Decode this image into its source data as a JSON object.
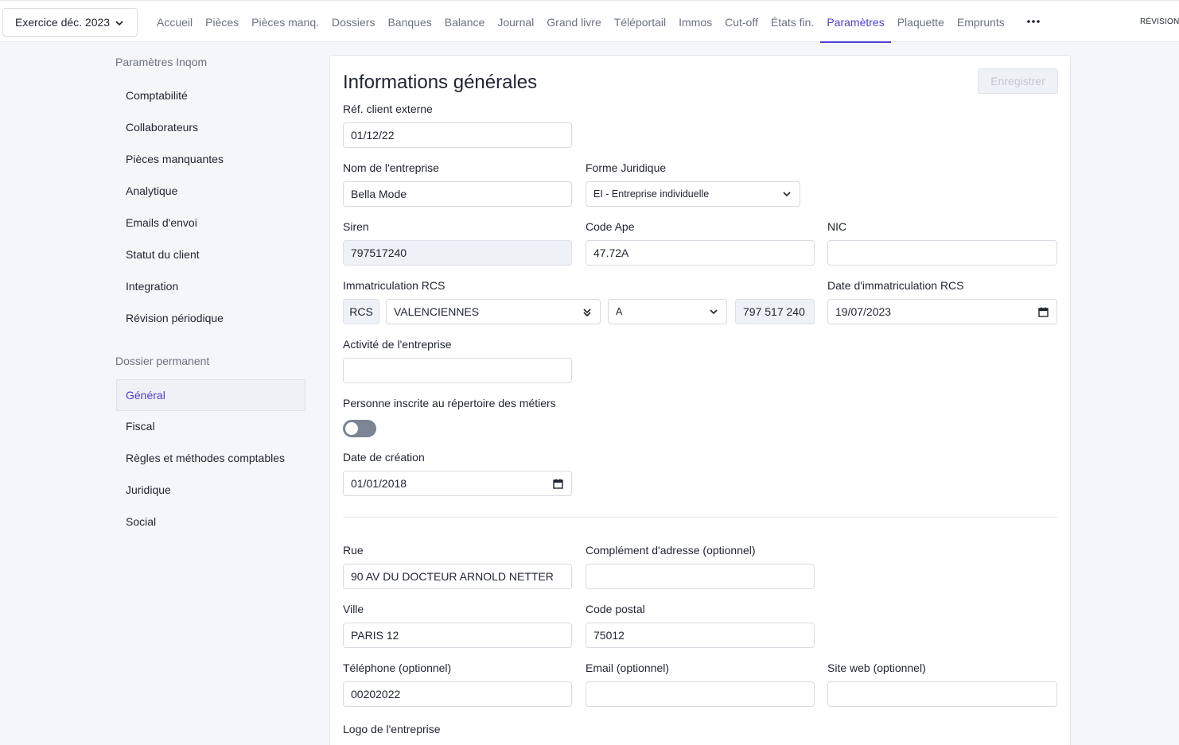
{
  "exercise": {
    "label": "Exercice déc. 2023"
  },
  "nav": {
    "items": [
      "Accueil",
      "Pièces",
      "Pièces manq.",
      "Dossiers",
      "Banques",
      "Balance",
      "Journal",
      "Grand livre",
      "Téléportail",
      "Immos",
      "Cut-off",
      "États fin.",
      "Paramètres",
      "Plaquette",
      "Emprunts"
    ],
    "active": "Paramètres",
    "revision": "RÉVISION"
  },
  "sidebar": {
    "section1": "Paramètres Inqom",
    "items1": [
      "Comptabilité",
      "Collaborateurs",
      "Pièces manquantes",
      "Analytique",
      "Emails d'envoi",
      "Statut du client",
      "Integration",
      "Révision périodique"
    ],
    "section2": "Dossier permanent",
    "items2": [
      "Général",
      "Fiscal",
      "Règles et méthodes comptables",
      "Juridique",
      "Social"
    ],
    "active": "Général"
  },
  "form": {
    "title": "Informations générales",
    "save_label": "Enregistrer",
    "ref_label": "Réf. client externe",
    "ref_value": "01/12/22",
    "company_label": "Nom de l'entreprise",
    "company_value": "Bella Mode",
    "legal_form_label": "Forme Juridique",
    "legal_form_value": "EI - Entreprise individuelle",
    "siren_label": "Siren",
    "siren_value": "797517240",
    "ape_label": "Code Ape",
    "ape_value": "47.72A",
    "nic_label": "NIC",
    "nic_value": "",
    "rcs_label": "Immatriculation RCS",
    "rcs_prefix": "RCS",
    "rcs_city": "VALENCIENNES",
    "rcs_letter": "A",
    "rcs_number": "797 517 240",
    "rcs_date_label": "Date d'immatriculation RCS",
    "rcs_date_value": "19/07/2023",
    "activity_label": "Activité de l'entreprise",
    "activity_value": "",
    "trades_label": "Personne inscrite au répertoire des métiers",
    "trades_enabled": false,
    "creation_label": "Date de création",
    "creation_value": "01/01/2018",
    "street_label": "Rue",
    "street_value": "90 AV DU DOCTEUR ARNOLD NETTER",
    "complement_label": "Complément d'adresse (optionnel)",
    "complement_value": "",
    "city_label": "Ville",
    "city_value": "PARIS 12",
    "postal_label": "Code postal",
    "postal_value": "75012",
    "phone_label": "Téléphone (optionnel)",
    "phone_value": "00202022",
    "email_label": "Email (optionnel)",
    "email_value": "",
    "website_label": "Site web (optionnel)",
    "website_value": "",
    "logo_label": "Logo de l'entreprise"
  },
  "colors": {
    "accent": "#4b3fcf",
    "toggle_off": "#7d8594",
    "disabled_field": "#eef1f5"
  }
}
